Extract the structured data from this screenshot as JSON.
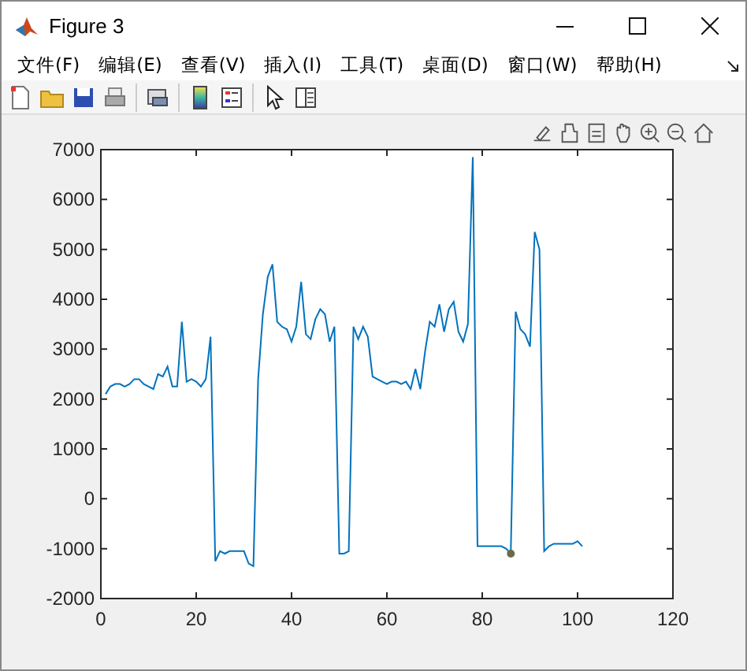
{
  "window": {
    "title": "Figure 3"
  },
  "menu": [
    "文件(F)",
    "编辑(E)",
    "查看(V)",
    "插入(I)",
    "工具(T)",
    "桌面(D)",
    "窗口(W)",
    "帮助(H)"
  ],
  "toolbar": [
    {
      "kind": "new"
    },
    {
      "kind": "open"
    },
    {
      "kind": "save"
    },
    {
      "kind": "print"
    },
    {
      "kind": "sep"
    },
    {
      "kind": "link"
    },
    {
      "kind": "sep"
    },
    {
      "kind": "colorbar"
    },
    {
      "kind": "legend"
    },
    {
      "kind": "sep"
    },
    {
      "kind": "pointer"
    },
    {
      "kind": "inspector"
    }
  ],
  "axes_toolbar": [
    {
      "kind": "brush"
    },
    {
      "kind": "datatip"
    },
    {
      "kind": "export"
    },
    {
      "kind": "pan"
    },
    {
      "kind": "zoomin"
    },
    {
      "kind": "zoomout"
    },
    {
      "kind": "home"
    }
  ],
  "plot": {
    "chart_data": {
      "type": "line",
      "x": [
        1,
        2,
        3,
        4,
        5,
        6,
        7,
        8,
        9,
        10,
        11,
        12,
        13,
        14,
        15,
        16,
        17,
        18,
        19,
        20,
        21,
        22,
        23,
        24,
        25,
        26,
        27,
        28,
        29,
        30,
        31,
        32,
        33,
        34,
        35,
        36,
        37,
        38,
        39,
        40,
        41,
        42,
        43,
        44,
        45,
        46,
        47,
        48,
        49,
        50,
        51,
        52,
        53,
        54,
        55,
        56,
        57,
        58,
        59,
        60,
        61,
        62,
        63,
        64,
        65,
        66,
        67,
        68,
        69,
        70,
        71,
        72,
        73,
        74,
        75,
        76,
        77,
        78,
        79,
        80,
        81,
        82,
        83,
        84,
        85,
        86,
        87,
        88,
        89,
        90,
        91,
        92,
        93,
        94,
        95,
        96,
        97,
        98,
        99,
        100,
        101
      ],
      "series": [
        {
          "color": "#0072bd",
          "values": [
            2100,
            2250,
            2300,
            2300,
            2250,
            2300,
            2400,
            2400,
            2300,
            2250,
            2200,
            2500,
            2450,
            2650,
            2250,
            2250,
            3550,
            2350,
            2400,
            2350,
            2250,
            2400,
            3250,
            -1250,
            -1050,
            -1100,
            -1050,
            -1050,
            -1050,
            -1050,
            -1300,
            -1350,
            2400,
            3700,
            4450,
            4700,
            3550,
            3450,
            3400,
            3150,
            3450,
            4350,
            3300,
            3200,
            3600,
            3800,
            3700,
            3150,
            3450,
            -1100,
            -1100,
            -1050,
            3450,
            3200,
            3450,
            3250,
            2450,
            2400,
            2350,
            2300,
            2350,
            2350,
            2300,
            2350,
            2200,
            2600,
            2200,
            2950,
            3550,
            3450,
            3900,
            3350,
            3800,
            3950,
            3350,
            3150,
            3500,
            6850,
            -950,
            -950,
            -950,
            -950,
            -950,
            -950,
            -1000,
            -1100,
            3750,
            3400,
            3300,
            3050,
            5350,
            5000,
            -1050,
            -950,
            -900,
            -900,
            -900,
            -900,
            -900,
            -850,
            -950
          ]
        },
        {
          "type": "scatter",
          "color": "#6b6b4a",
          "values": [
            null,
            null,
            null,
            null,
            null,
            null,
            null,
            null,
            null,
            null,
            null,
            null,
            null,
            null,
            null,
            null,
            null,
            null,
            null,
            null,
            null,
            null,
            null,
            null,
            null,
            null,
            null,
            null,
            null,
            null,
            null,
            null,
            null,
            null,
            null,
            null,
            null,
            null,
            null,
            null,
            null,
            null,
            null,
            null,
            null,
            null,
            null,
            null,
            null,
            null,
            null,
            null,
            null,
            null,
            null,
            null,
            null,
            null,
            null,
            null,
            null,
            null,
            null,
            null,
            null,
            null,
            null,
            null,
            null,
            null,
            null,
            null,
            null,
            null,
            null,
            null,
            null,
            null,
            null,
            null,
            null,
            null,
            null,
            null,
            null,
            -1100,
            null,
            null,
            null,
            null,
            null,
            null,
            null,
            null,
            null,
            null,
            null,
            null,
            null,
            null,
            null
          ]
        }
      ],
      "xlim": [
        0,
        120
      ],
      "ylim": [
        -2000,
        7000
      ],
      "xticks": [
        0,
        20,
        40,
        60,
        80,
        100,
        120
      ],
      "yticks": [
        -2000,
        -1000,
        0,
        1000,
        2000,
        3000,
        4000,
        5000,
        6000,
        7000
      ]
    }
  }
}
